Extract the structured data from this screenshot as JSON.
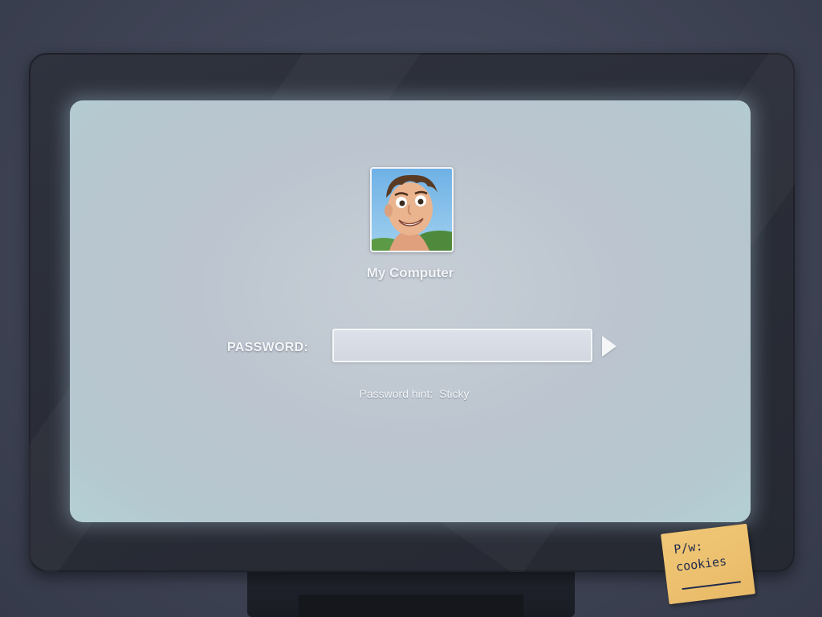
{
  "monitor": {
    "computer_name": "My Computer",
    "avatar": {
      "icon": "user-avatar-portrait",
      "alt": "User avatar"
    },
    "password": {
      "label": "PASSWORD:",
      "value": "",
      "placeholder": ""
    },
    "submit_icon": "play-arrow-icon",
    "hint": {
      "label": "Password hint:",
      "value": "Sticky"
    }
  },
  "sticky_note": {
    "line1": "P/w:",
    "line2": "cookies"
  },
  "colors": {
    "screen": "#bfc8d1",
    "bezel": "#2b2e38",
    "room": "#3f4557",
    "sticky": "#ebbf6c",
    "text": "#f2f4f7"
  }
}
